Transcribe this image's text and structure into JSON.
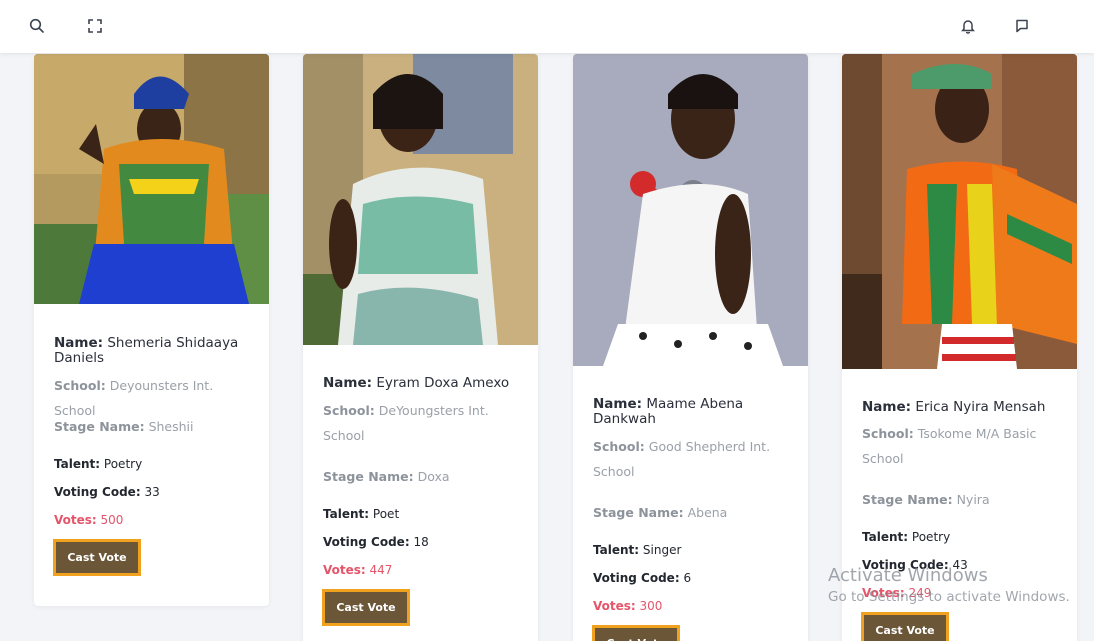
{
  "header": {
    "icons": [
      "search-icon",
      "fullscreen-icon",
      "bell-icon",
      "message-icon"
    ]
  },
  "labels": {
    "name": "Name:",
    "school": "School:",
    "stage_name": "Stage Name:",
    "talent": "Talent:",
    "voting_code": "Voting Code:",
    "votes": "Votes:",
    "cast_vote": "Cast Vote"
  },
  "contestants": [
    {
      "name": "Shemeria Shidaaya Daniels",
      "school": "Deyounsters Int. School",
      "stage_name": "Sheshii",
      "talent": "Poetry",
      "voting_code": "33",
      "votes": "500"
    },
    {
      "name": "Eyram Doxa Amexo",
      "school": "DeYoungsters Int. School",
      "stage_name": "Doxa",
      "talent": "Poet",
      "voting_code": "18",
      "votes": "447"
    },
    {
      "name": "Maame Abena Dankwah",
      "school": "Good Shepherd Int. School",
      "stage_name": "Abena",
      "talent": "Singer",
      "voting_code": "6",
      "votes": "300"
    },
    {
      "name": "Erica Nyira Mensah",
      "school": "Tsokome M/A Basic School",
      "stage_name": "Nyira",
      "talent": "Poetry",
      "voting_code": "43",
      "votes": "249"
    }
  ],
  "watermark": {
    "line1": "Activate Windows",
    "line2": "Go to Settings to activate Windows."
  },
  "colors": {
    "button_bg": "#6b5637",
    "button_border": "#f0a11d",
    "votes": "#e4556a",
    "page_bg": "#f2f4f7"
  }
}
